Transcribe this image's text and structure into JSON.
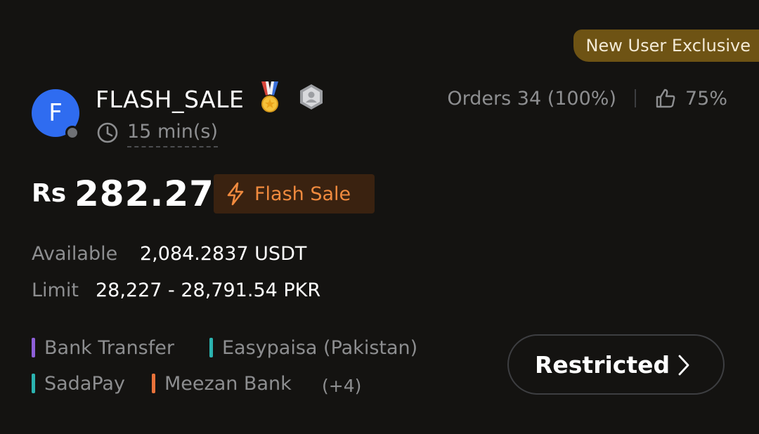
{
  "badge": {
    "new_user": "New User Exclusive"
  },
  "merchant": {
    "avatar_letter": "F",
    "name": "FLASH_SALE",
    "medal_icon": "medal-icon",
    "verified_icon": "shield-user-icon",
    "time": "15 min(s)",
    "online_status": "offline"
  },
  "stats": {
    "orders": "Orders 34 (100%)",
    "rating": "75%"
  },
  "price": {
    "currency": "Rs",
    "value": "282.27",
    "flash_label": "Flash Sale"
  },
  "available": {
    "label": "Available",
    "value": "2,084.2837 USDT"
  },
  "limit": {
    "label": "Limit",
    "value": "28,227 - 28,791.54 PKR"
  },
  "payments": {
    "methods": [
      {
        "name": "Bank Transfer",
        "color": "#8e5fd8"
      },
      {
        "name": "Easypaisa (Pakistan)",
        "color": "#2bb3b0"
      },
      {
        "name": "SadaPay",
        "color": "#2bb3b0"
      },
      {
        "name": "Meezan Bank",
        "color": "#e8723a"
      }
    ],
    "more": "(+4)"
  },
  "action": {
    "label": "Restricted"
  },
  "colors": {
    "background": "#141311",
    "accent_orange": "#f08a3e",
    "badge_gold": "#6e5314",
    "avatar_blue": "#2f6cf0"
  }
}
